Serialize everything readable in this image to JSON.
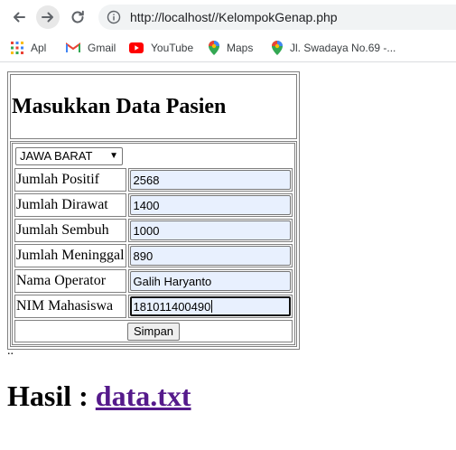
{
  "browser": {
    "url": "http://localhost//KelompokGenap.php",
    "bookmarks": [
      {
        "label": "Apl",
        "icon": "apps-grid-icon"
      },
      {
        "label": "Gmail",
        "icon": "gmail-icon"
      },
      {
        "label": "YouTube",
        "icon": "youtube-icon"
      },
      {
        "label": "Maps",
        "icon": "maps-pin-icon"
      },
      {
        "label": "Jl. Swadaya No.69 -...",
        "icon": "maps-pin-icon"
      }
    ]
  },
  "form": {
    "title": "Masukkan Data Pasien",
    "province_selected": "JAWA BARAT",
    "fields": [
      {
        "label": "Jumlah Positif",
        "value": "2568"
      },
      {
        "label": "Jumlah Dirawat",
        "value": "1400"
      },
      {
        "label": "Jumlah Sembuh",
        "value": "1000"
      },
      {
        "label": "Jumlah Meninggal",
        "value": "890"
      },
      {
        "label": "Nama Operator",
        "value": "Galih Haryanto"
      },
      {
        "label": "NIM Mahasiswa",
        "value": "181011400490"
      }
    ],
    "submit_label": "Simpan"
  },
  "result": {
    "dots": "..",
    "prefix": "Hasil : ",
    "link_text": "data.txt"
  }
}
